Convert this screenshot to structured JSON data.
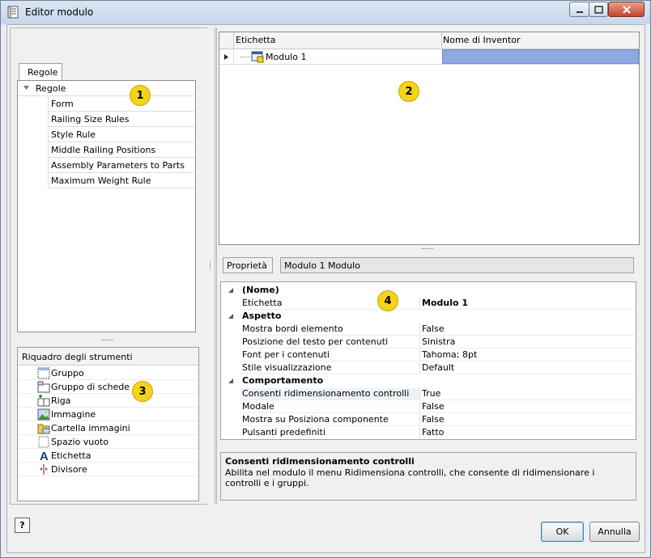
{
  "window": {
    "title": "Editor modulo"
  },
  "rules_tab": {
    "label": "Regole"
  },
  "rules_tree": {
    "root": "Regole",
    "items": [
      "Form",
      "Railing Size Rules",
      "Style Rule",
      "Middle Railing Positions",
      "Assembly Parameters to Parts",
      "Maximum Weight Rule"
    ]
  },
  "callouts": [
    "1",
    "2",
    "3",
    "4"
  ],
  "toolbox": {
    "title": "Riquadro degli strumenti",
    "items": [
      {
        "label": "Gruppo",
        "icon": "group-icon"
      },
      {
        "label": "Gruppo di schede",
        "icon": "tab-group-icon"
      },
      {
        "label": "Riga",
        "icon": "row-icon"
      },
      {
        "label": "Immagine",
        "icon": "picture-icon"
      },
      {
        "label": "Cartella immagini",
        "icon": "picture-folder-icon"
      },
      {
        "label": "Spazio vuoto",
        "icon": "empty-space-icon"
      },
      {
        "label": "Etichetta",
        "icon": "label-icon"
      },
      {
        "label": "Divisore",
        "icon": "splitter-icon"
      }
    ]
  },
  "form_grid": {
    "columns": [
      "Etichetta",
      "Nome di Inventor"
    ],
    "rows": [
      {
        "label": "Modulo 1",
        "inventor_name": ""
      }
    ]
  },
  "properties": {
    "label": "Proprietà",
    "selected": "Modulo 1 Modulo",
    "grid": [
      {
        "type": "category",
        "name": "(Nome)"
      },
      {
        "type": "prop",
        "key": "Etichetta",
        "value": "Modulo 1",
        "bold": true
      },
      {
        "type": "category",
        "name": "Aspetto"
      },
      {
        "type": "prop",
        "key": "Mostra bordi elemento",
        "value": "False"
      },
      {
        "type": "prop",
        "key": "Posizione del testo per contenuti",
        "value": "Sinistra"
      },
      {
        "type": "prop",
        "key": "Font per i contenuti",
        "value": "Tahoma; 8pt"
      },
      {
        "type": "prop",
        "key": "Stile visualizzazione",
        "value": "Default"
      },
      {
        "type": "category",
        "name": "Comportamento"
      },
      {
        "type": "prop",
        "key": "Consenti ridimensionamento controlli",
        "value": "True",
        "selected": true
      },
      {
        "type": "prop",
        "key": "Modale",
        "value": "False"
      },
      {
        "type": "prop",
        "key": "Mostra su Posiziona componente",
        "value": "False"
      },
      {
        "type": "prop",
        "key": "Pulsanti predefiniti",
        "value": "Fatto"
      }
    ],
    "description": {
      "title": "Consenti ridimensionamento controlli",
      "text": "Abilita nel modulo il menu Ridimensiona controlli, che consente di ridimensionare i controlli e i gruppi."
    }
  },
  "buttons": {
    "help": "?",
    "ok": "OK",
    "cancel": "Annulla"
  },
  "colors": {
    "selection": "#8ea9e0",
    "callout": "#f5d31a",
    "window_frame": "#c6d6ea"
  }
}
